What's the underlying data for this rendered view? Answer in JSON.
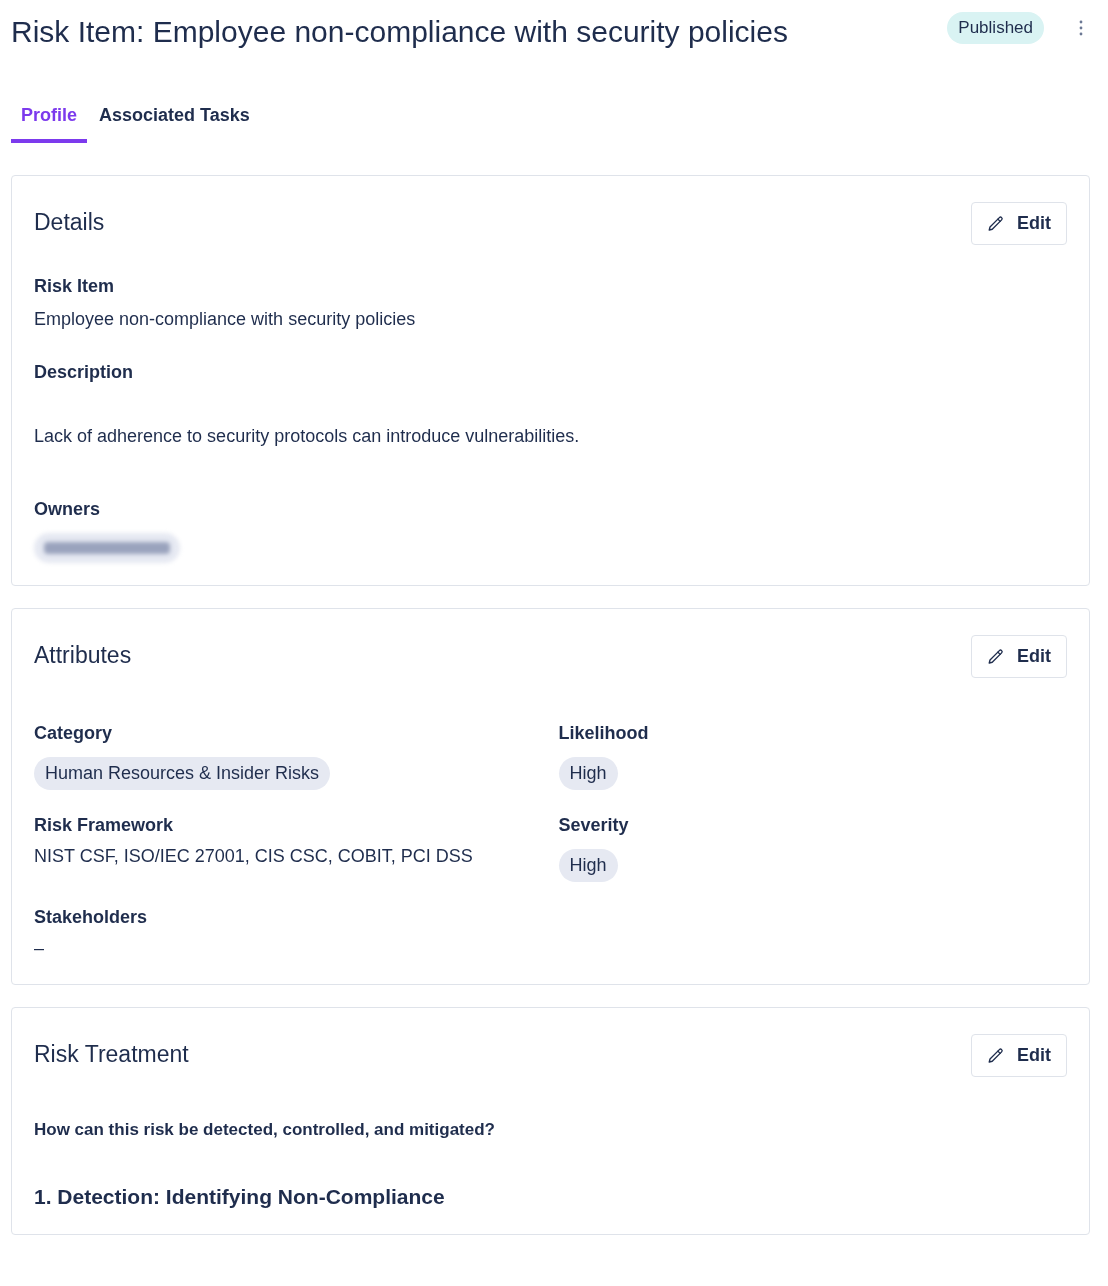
{
  "title": "Risk Item: Employee non-compliance with security policies",
  "status": "Published",
  "tabs": [
    {
      "label": "Profile",
      "selected": true
    },
    {
      "label": "Associated Tasks",
      "selected": false
    }
  ],
  "details": {
    "heading": "Details",
    "edit": "Edit",
    "fields": [
      {
        "label": "Risk Item",
        "value": "Employee non-compliance with security policies",
        "kind": "text"
      },
      {
        "label": "Description",
        "value": "Lack of adherence to security protocols can introduce vulnerabilities.",
        "kind": "paragraph"
      }
    ],
    "owners_label": "Owners",
    "owners": [
      {
        "kind": "redacted"
      }
    ]
  },
  "attributes": {
    "heading": "Attributes",
    "edit": "Edit",
    "fields": [
      {
        "label": "Category",
        "value": "Human Resources & Insider Risks",
        "kind": "chip"
      },
      {
        "label": "Likelihood",
        "value": "High",
        "kind": "chip"
      },
      {
        "label": "Risk Framework",
        "value": "NIST CSF, ISO/IEC 27001, CIS CSC, COBIT, PCI DSS",
        "kind": "text"
      },
      {
        "label": "Severity",
        "value": "High",
        "kind": "chip"
      },
      {
        "label": "Stakeholders",
        "value": "–",
        "kind": "text"
      }
    ]
  },
  "treatment": {
    "heading": "Risk Treatment",
    "edit": "Edit",
    "question": "How can this risk be detected, controlled, and mitigated?",
    "section_heading": "1. Detection: Identifying Non-Compliance"
  }
}
